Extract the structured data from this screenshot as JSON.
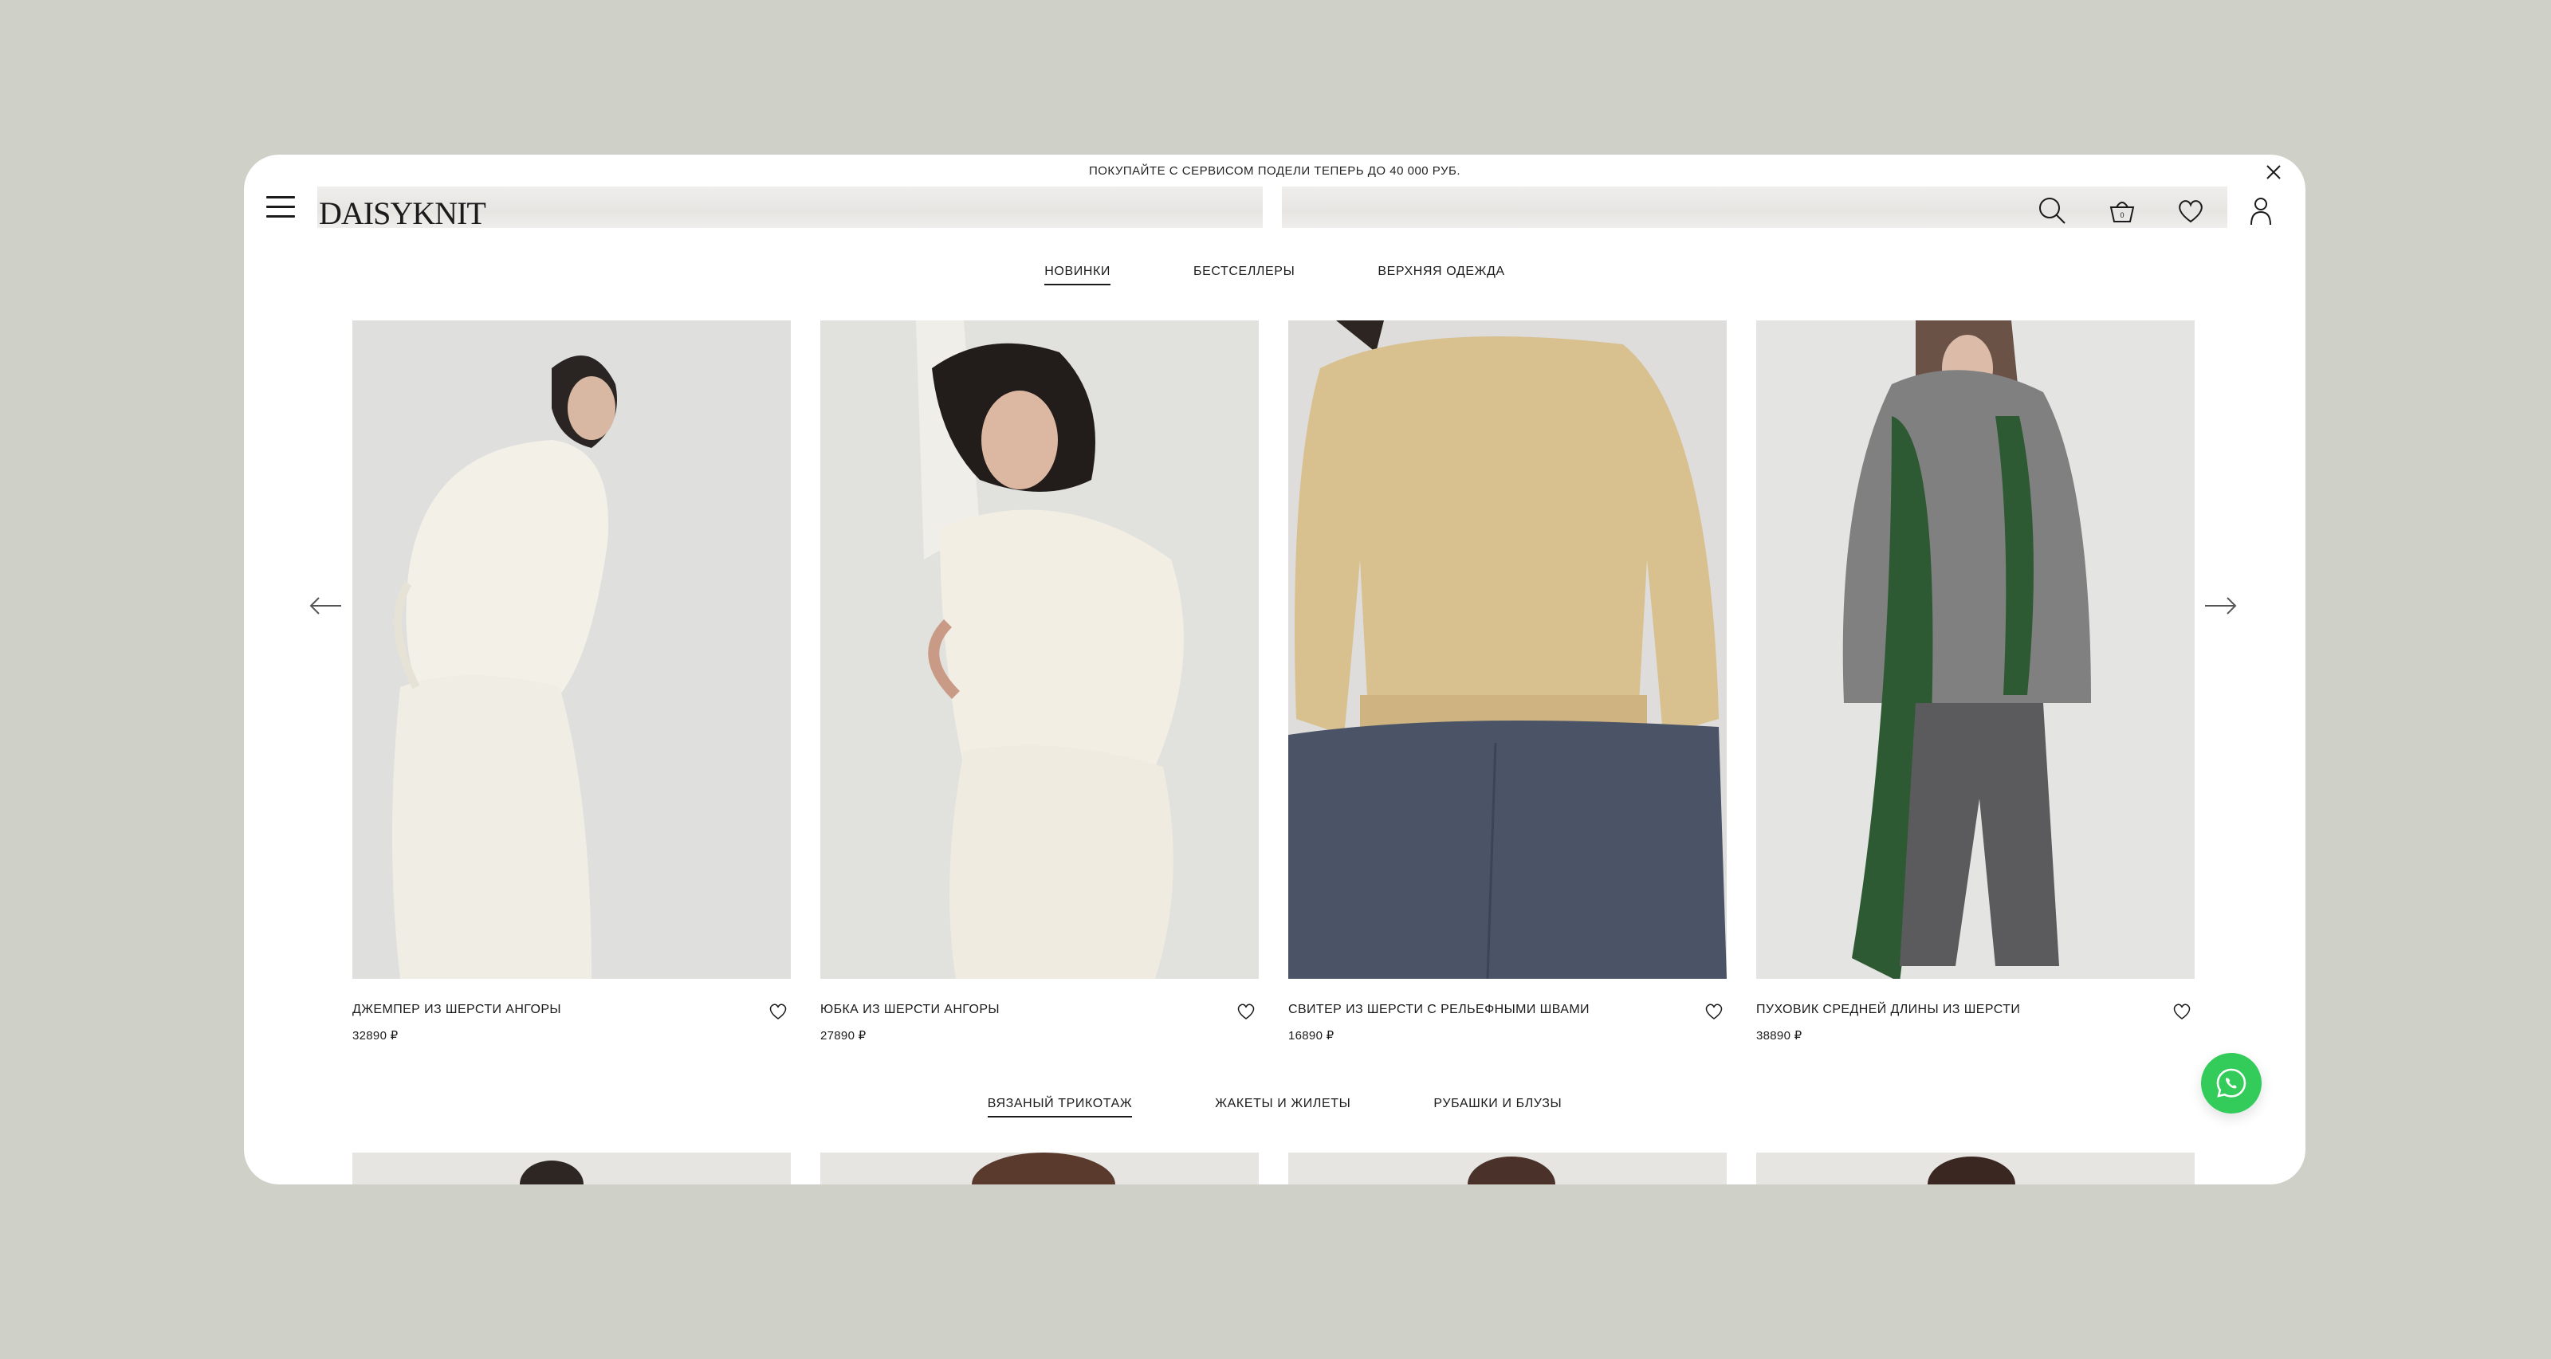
{
  "announcement": {
    "text": "ПОКУПАЙТЕ С СЕРВИСОМ ПОДЕЛИ ТЕПЕРЬ ДО 40 000 РУБ."
  },
  "header": {
    "logo": "DAISYKNIT",
    "icons": [
      "menu-icon",
      "search-icon",
      "cart-icon",
      "heart-icon",
      "user-icon"
    ],
    "cart_count": "0"
  },
  "tabs_top": [
    {
      "label": "НОВИНКИ",
      "active": true
    },
    {
      "label": "БЕСТСЕЛЛЕРЫ",
      "active": false
    },
    {
      "label": "ВЕРХНЯЯ ОДЕЖДА",
      "active": false
    }
  ],
  "products": [
    {
      "name": "ДЖЕМПЕР ИЗ ШЕРСТИ АНГОРЫ",
      "price": "32890 ₽"
    },
    {
      "name": "ЮБКА ИЗ ШЕРСТИ АНГОРЫ",
      "price": "27890 ₽"
    },
    {
      "name": "СВИТЕР ИЗ ШЕРСТИ С РЕЛЬЕФНЫМИ ШВАМИ",
      "price": "16890 ₽"
    },
    {
      "name": "ПУХОВИК СРЕДНЕЙ ДЛИНЫ ИЗ ШЕРСТИ",
      "price": "38890 ₽"
    }
  ],
  "tabs_bottom": [
    {
      "label": "ВЯЗАНЫЙ ТРИКОТАЖ",
      "active": true
    },
    {
      "label": "ЖАКЕТЫ И ЖИЛЕТЫ",
      "active": false
    },
    {
      "label": "РУБАШКИ И БЛУЗЫ",
      "active": false
    }
  ],
  "colors": {
    "page_bg": "#cfd0c8",
    "window_bg": "#ffffff",
    "text": "#1b1b1b",
    "whatsapp": "#33cc5a"
  }
}
